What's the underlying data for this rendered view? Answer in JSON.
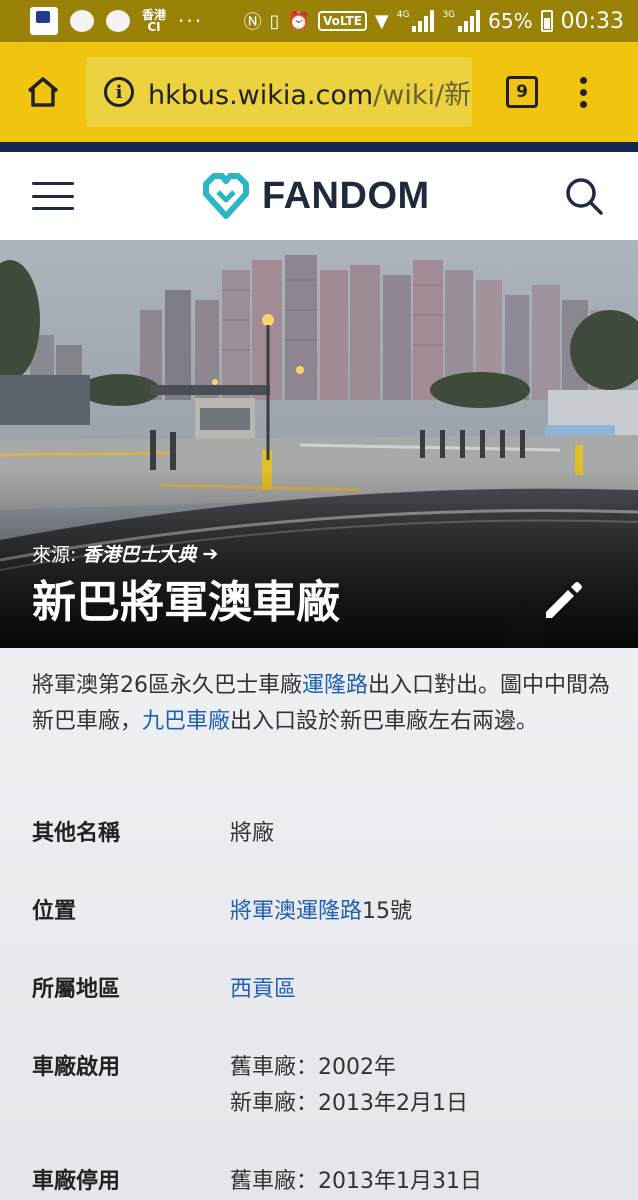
{
  "status_bar": {
    "app_badge": "Gallo Baoul",
    "carrier_label": "香港\nCI",
    "more": "···",
    "volte": "VoLTE",
    "net1": "4G",
    "net2": "3G",
    "battery_pct": "65%",
    "time": "00:33"
  },
  "browser": {
    "url_domain": "hkbus.wikia.com",
    "url_path": "/wiki/新",
    "tab_count": "9",
    "toolbar_color": "#f1c40f"
  },
  "fandom": {
    "logo_text": "FANDOM",
    "logo_colors": [
      "#2bb6c4",
      "#1f2b3d"
    ]
  },
  "hero": {
    "source_prefix": "來源: ",
    "source_link": "香港巴士大典",
    "source_arrow": "➔",
    "title": "新巴將軍澳車廠"
  },
  "caption": {
    "t1": "將軍澳第26區永久巴士車廠",
    "link1": "運隆路",
    "t2": "出入口對出。圖中中間為新巴車廠，",
    "link2": "九巴車廠",
    "t3": "出入口設於新巴車廠左右兩邊。"
  },
  "infobox": {
    "other_names": {
      "label": "其他名稱",
      "value": "將廠"
    },
    "location": {
      "label": "位置",
      "link": "將軍澳運隆路",
      "text": "15號"
    },
    "district": {
      "label": "所屬地區",
      "link": "西貢區"
    },
    "opened": {
      "label": "車廠啟用",
      "line1": "舊車廠：2002年",
      "line2": "新車廠：2013年2月1日"
    },
    "closed": {
      "label": "車廠停用",
      "line1": "舊車廠：2013年1月31日"
    }
  },
  "link_color": "#1f5fb4"
}
